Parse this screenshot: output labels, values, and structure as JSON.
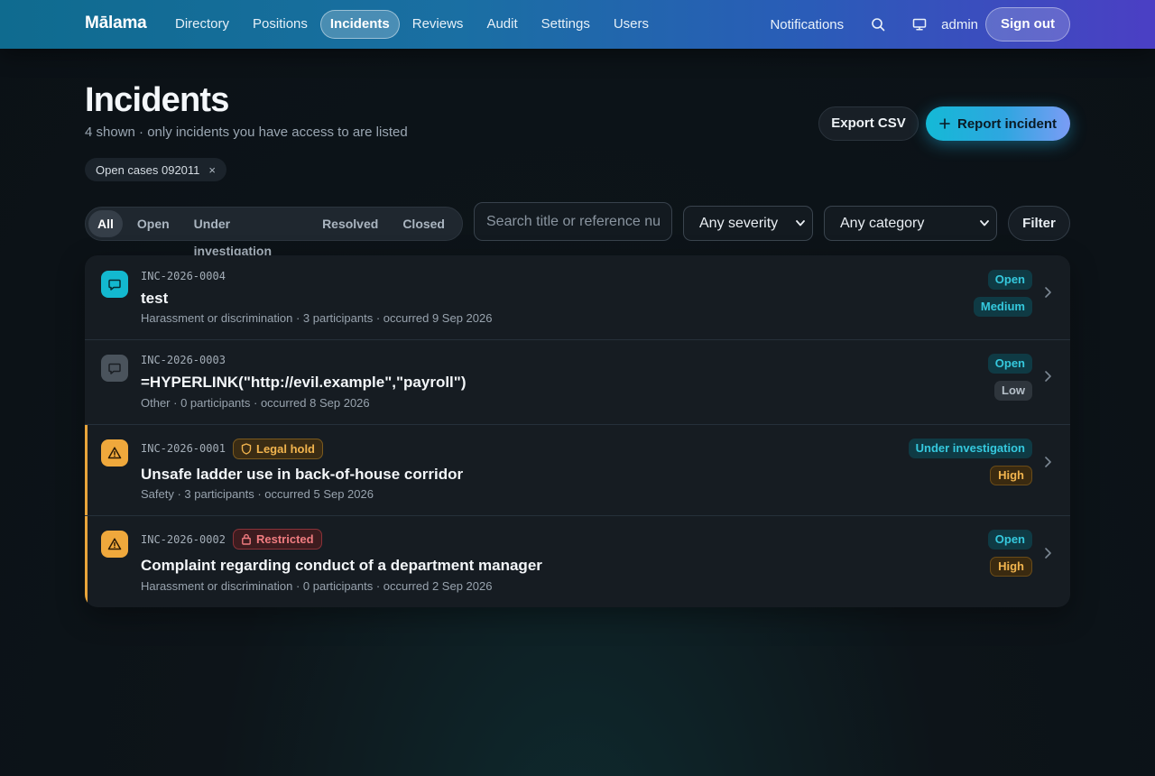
{
  "app": {
    "brand": "Mālama"
  },
  "nav": {
    "items": [
      "Directory",
      "Positions",
      "Incidents",
      "Reviews",
      "Audit",
      "Settings",
      "Users"
    ],
    "active": "Incidents",
    "notifications_label": "Notifications",
    "user": "admin",
    "sign_out_label": "Sign out"
  },
  "header": {
    "title": "Incidents",
    "subtitle": "4 shown · only incidents you have access to are listed",
    "chip": "Open cases 092011",
    "chip_close": "×",
    "export_label": "Export CSV",
    "report_label": "Report incident"
  },
  "filters": {
    "status_tabs": [
      "All",
      "Open",
      "Under investigation",
      "Resolved",
      "Closed"
    ],
    "active_tab": "All",
    "search_placeholder": "Search title or reference number",
    "search_value": "",
    "severity_selected": "Any severity",
    "category_selected": "Any category",
    "filter_label": "Filter"
  },
  "incidents": [
    {
      "ref": "INC-2026-0004",
      "tag": "",
      "title": "test",
      "meta": "Harassment or discrimination · 3 participants · occurred 9 Sep 2026",
      "status": "Open",
      "severity": "Medium",
      "icon": "message-icon",
      "icon_color": "#13b8cf"
    },
    {
      "ref": "INC-2026-0003",
      "tag": "",
      "title": "=HYPERLINK(\"http://evil.example\",\"payroll\")",
      "meta": "Other · 0 participants · occurred 8 Sep 2026",
      "status": "Open",
      "severity": "Low",
      "icon": "message-icon",
      "icon_color": "#4a535c"
    },
    {
      "ref": "INC-2026-0001",
      "tag": "Legal hold",
      "tag_icon": "shield-icon",
      "title": "Unsafe ladder use in back-of-house corridor",
      "meta": "Safety · 3 participants · occurred 5 Sep 2026",
      "status": "Under investigation",
      "severity": "High",
      "icon": "warning-icon",
      "icon_color": "#efa83c"
    },
    {
      "ref": "INC-2026-0002",
      "tag": "Restricted",
      "tag_icon": "lock-icon",
      "title": "Complaint regarding conduct of a department manager",
      "meta": "Harassment or discrimination · 0 participants · occurred 2 Sep 2026",
      "status": "Open",
      "severity": "High",
      "icon": "warning-icon",
      "icon_color": "#efa83c"
    }
  ],
  "colors": {
    "accent": "#14b9d6",
    "warning": "#efa83c",
    "restricted": "#f07c80"
  }
}
